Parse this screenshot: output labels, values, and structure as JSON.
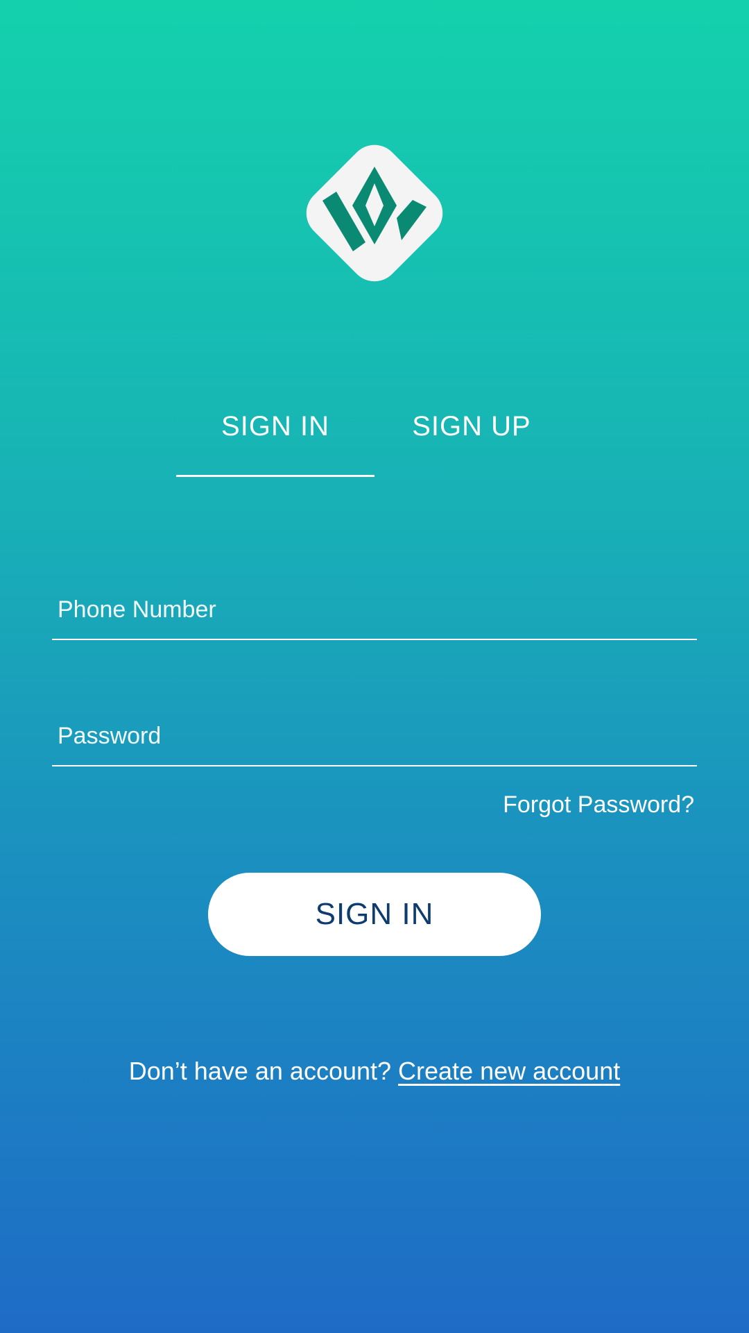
{
  "logo": {
    "icon": "brand-logo-icon",
    "background_color": "#f4f4f4",
    "mark_color": "#0a8a72"
  },
  "tabs": [
    {
      "label": "SIGN IN",
      "selected": true
    },
    {
      "label": "SIGN UP",
      "selected": false
    }
  ],
  "form": {
    "phone_placeholder": "Phone Number",
    "phone_value": "",
    "password_placeholder": "Password",
    "password_value": "",
    "forgot_label": "Forgot Password?",
    "submit_label": "SIGN IN"
  },
  "footer": {
    "prompt": "Don’t have an account?",
    "create_label": "Create new account"
  },
  "colors": {
    "gradient_top": "#14d1ac",
    "gradient_bottom": "#1e6bc6",
    "button_text": "#0f3c70"
  }
}
